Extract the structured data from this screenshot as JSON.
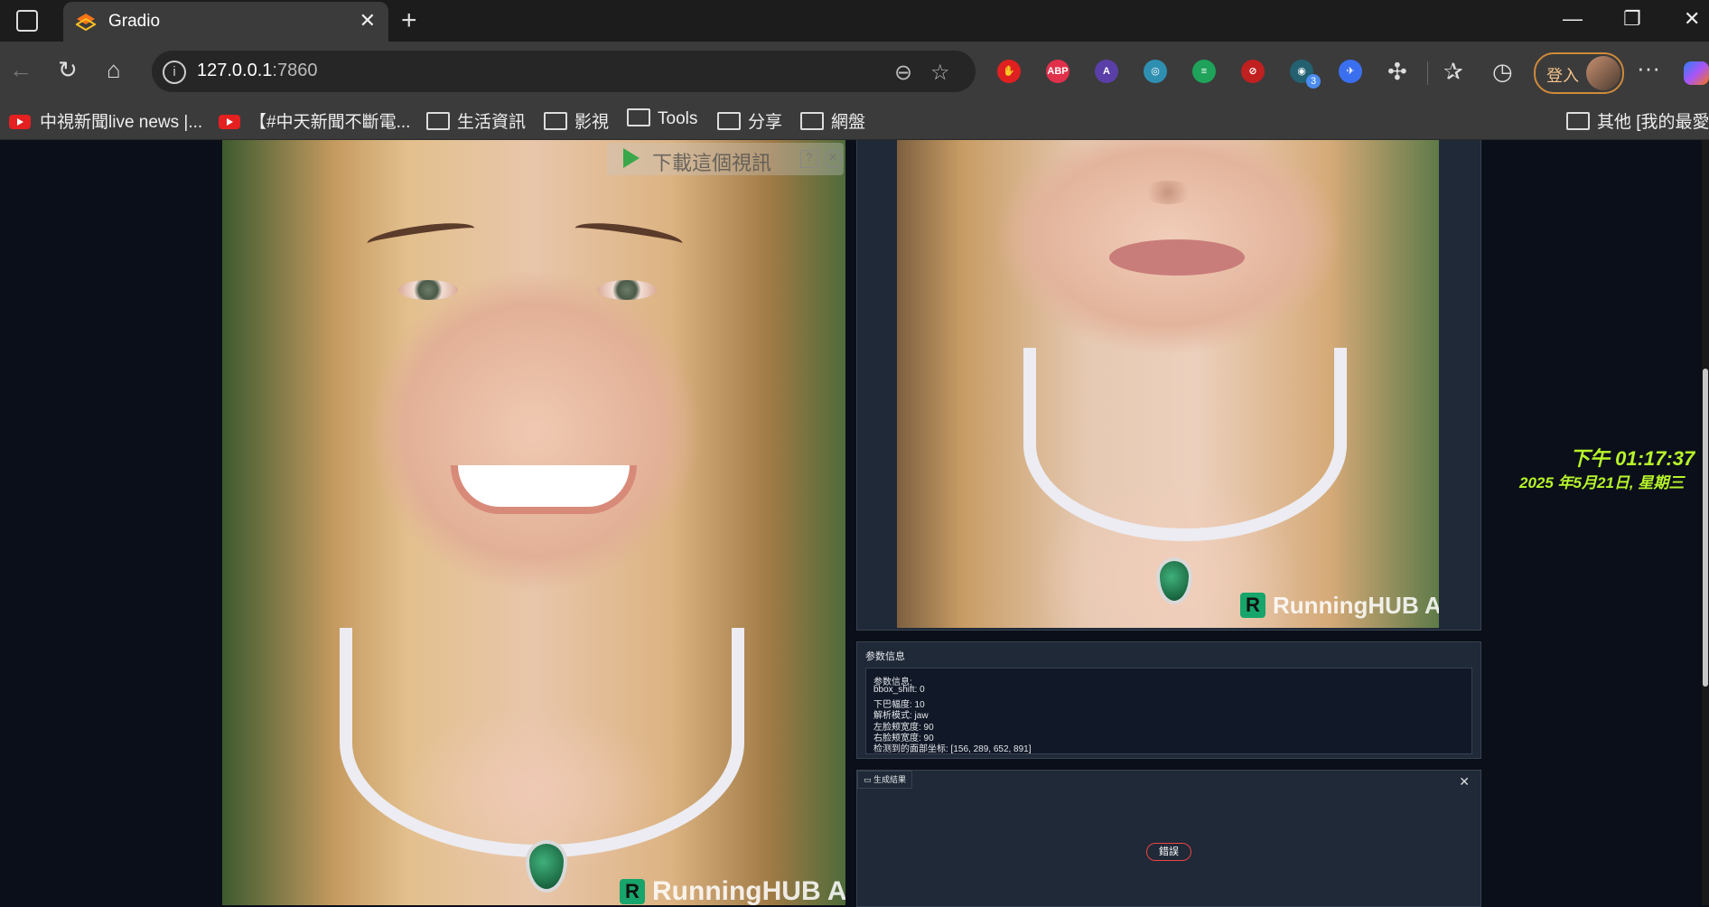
{
  "tab": {
    "title": "Gradio",
    "close": "✕"
  },
  "new_tab": "+",
  "window": {
    "minimize": "—",
    "restore": "❐",
    "close": "✕"
  },
  "address": {
    "host": "127.0.0.1",
    "port": ":7860"
  },
  "extensions": [
    {
      "name": "hand-stop-icon",
      "label": "✋",
      "color": "#e02020"
    },
    {
      "name": "adblock-plus-icon",
      "label": "ABP",
      "color": "#e0304a"
    },
    {
      "name": "shield-a-icon",
      "label": "A",
      "color": "#5a3fa8"
    },
    {
      "name": "globe-icon",
      "label": "◎",
      "color": "#2f8fb0"
    },
    {
      "name": "stripes-icon",
      "label": "≡",
      "color": "#1fa35a"
    },
    {
      "name": "blocked-icon",
      "label": "⊘",
      "color": "#c02020"
    },
    {
      "name": "mask-icon",
      "label": "◉",
      "color": "#236070"
    },
    {
      "name": "bird-icon",
      "label": "✈",
      "color": "#3a6ff0"
    }
  ],
  "extension_badge": "3",
  "profile": {
    "signin_label": "登入"
  },
  "bookmarks": {
    "items": [
      {
        "label": "中視新聞live news |...",
        "kind": "youtube"
      },
      {
        "label": "【#中天新聞不斷電...",
        "kind": "youtube"
      },
      {
        "label": "生活資訊",
        "kind": "folder"
      },
      {
        "label": "影視",
        "kind": "folder"
      },
      {
        "label": "Tools",
        "kind": "folder"
      },
      {
        "label": "分享",
        "kind": "folder"
      },
      {
        "label": "網盤",
        "kind": "folder"
      }
    ],
    "other": "其他 [我的最愛]"
  },
  "overlay": {
    "label": "下載這個視訊",
    "help": "?",
    "close": "✕"
  },
  "watermark": {
    "logo": "R",
    "text": "RunningHUB AI"
  },
  "info_panel": {
    "title": "参数信息",
    "lines": [
      "参数信息:",
      "bbox_shift: 0",
      "下巴幅度: 10",
      "解析模式: jaw",
      "左脸颊宽度: 90",
      "右脸颊宽度: 90",
      "检测到的面部坐标: [156, 289, 652, 891]"
    ]
  },
  "result_panel": {
    "label": "生成結果",
    "close": "✕",
    "error": "錯誤"
  },
  "clock": {
    "time": "下午 01:17:37",
    "date": "2025 年5月21日, 星期三"
  }
}
